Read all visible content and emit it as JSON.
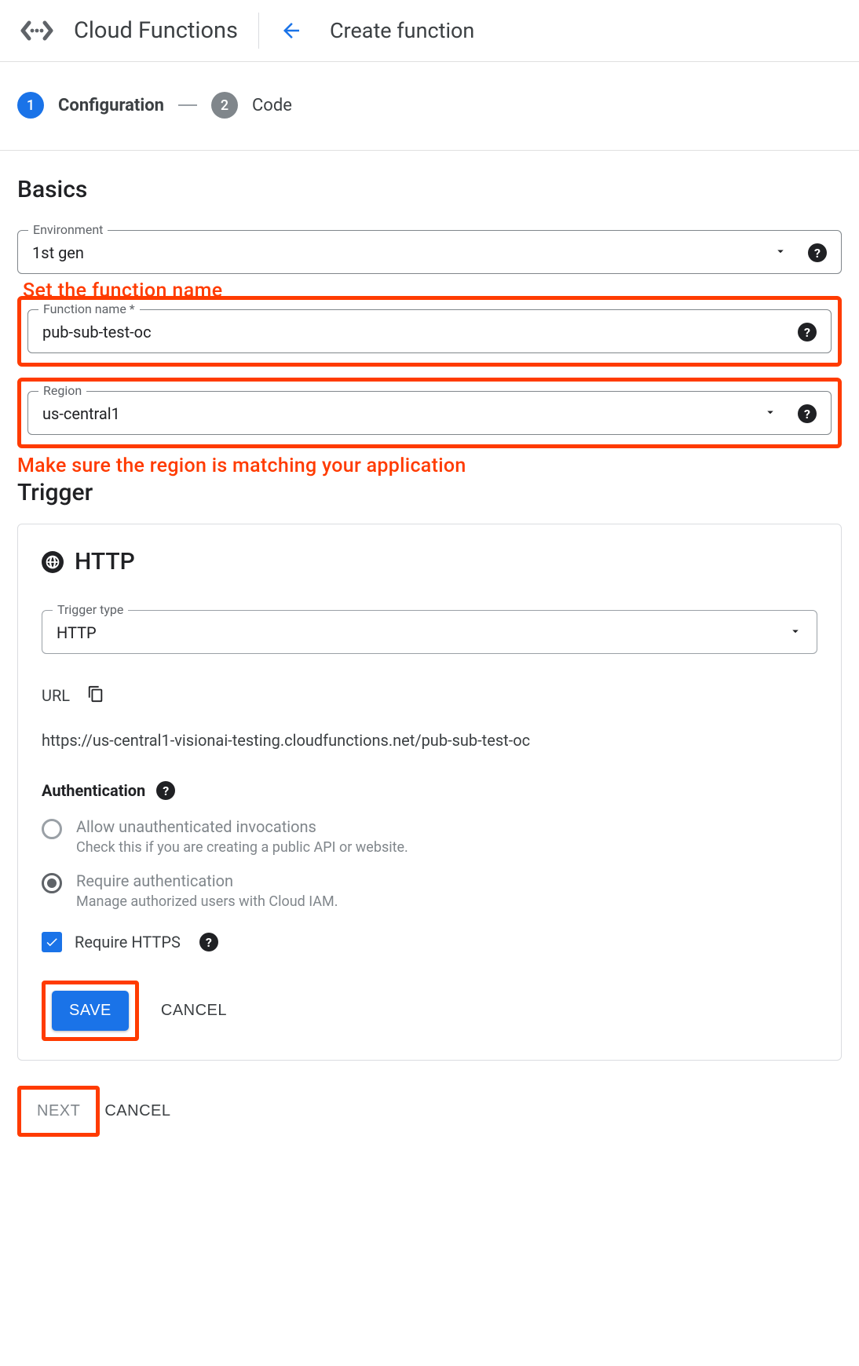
{
  "header": {
    "product": "Cloud Functions",
    "page": "Create function"
  },
  "stepper": {
    "step1": {
      "num": "1",
      "label": "Configuration"
    },
    "step2": {
      "num": "2",
      "label": "Code"
    }
  },
  "basics": {
    "title": "Basics",
    "environment": {
      "legend": "Environment",
      "value": "1st gen"
    },
    "function_name": {
      "legend": "Function name *",
      "value": "pub-sub-test-oc"
    },
    "region": {
      "legend": "Region",
      "value": "us-central1"
    }
  },
  "annotations": {
    "name": "Set the function name",
    "region": "Make sure the region is matching your application"
  },
  "trigger": {
    "title": "Trigger",
    "http_label": "HTTP",
    "type": {
      "legend": "Trigger type",
      "value": "HTTP"
    },
    "url_label": "URL",
    "url_value": "https://us-central1-visionai-testing.cloudfunctions.net/pub-sub-test-oc",
    "auth_title": "Authentication",
    "option1": {
      "label": "Allow unauthenticated invocations",
      "sub": "Check this if you are creating a public API or website."
    },
    "option2": {
      "label": "Require authentication",
      "sub": "Manage authorized users with Cloud IAM."
    },
    "require_https": "Require HTTPS",
    "save": "SAVE",
    "cancel": "CANCEL"
  },
  "footer": {
    "next": "NEXT",
    "cancel": "CANCEL"
  }
}
